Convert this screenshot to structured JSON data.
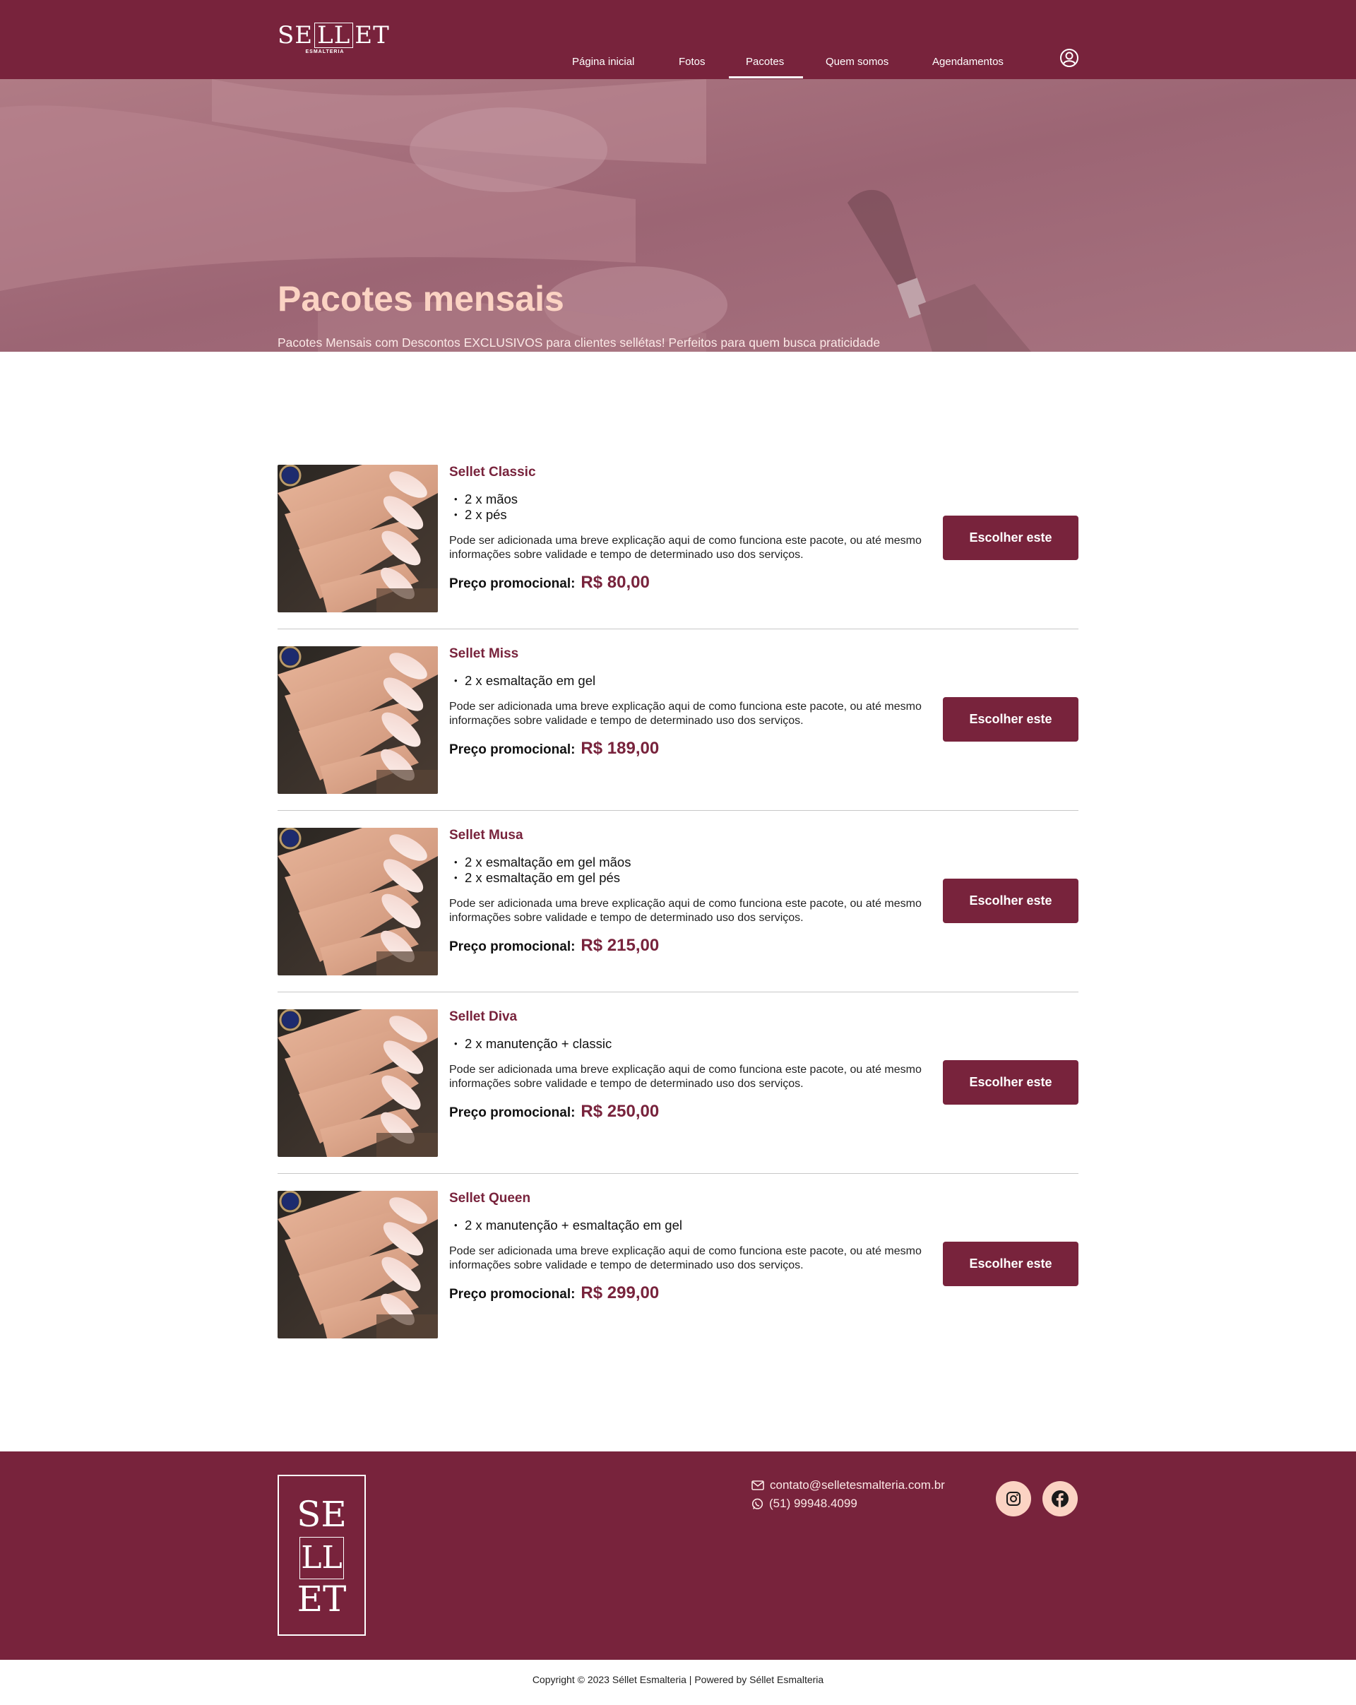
{
  "header": {
    "logo_text_left": "SE",
    "logo_text_box": "LL",
    "logo_text_right": "ET",
    "logo_subtitle": "ESMALTERIA",
    "nav": [
      {
        "label": "Página inicial"
      },
      {
        "label": "Fotos"
      },
      {
        "label": "Pacotes",
        "active": true
      },
      {
        "label": "Quem somos"
      },
      {
        "label": "Agendamentos"
      }
    ],
    "user_icon": "user-circle-icon"
  },
  "hero": {
    "title": "Pacotes mensais",
    "description": "Pacotes Mensais com Descontos EXCLUSIVOS para clientes sellétas! Perfeitos para quem busca praticidade e agendamentos fixos."
  },
  "packages": [
    {
      "name": "Sellet Classic",
      "items": [
        "2 x mãos",
        "2 x pés"
      ],
      "description": "Pode ser adicionada uma breve explicação aqui de como funciona este pacote, ou até mesmo informações sobre validade e tempo de determinado uso dos serviços.",
      "price_label": "Preço promocional:",
      "price": "R$ 80,00",
      "button": "Escolher este"
    },
    {
      "name": "Sellet Miss",
      "items": [
        "2 x esmaltação em gel"
      ],
      "description": "Pode ser adicionada uma breve explicação aqui de como funciona este pacote, ou até mesmo informações sobre validade e tempo de determinado uso dos serviços.",
      "price_label": "Preço promocional:",
      "price": "R$ 189,00",
      "button": "Escolher este"
    },
    {
      "name": "Sellet Musa",
      "items": [
        "2 x esmaltação em gel mãos",
        "2 x esmaltação em gel pés"
      ],
      "description": "Pode ser adicionada uma breve explicação aqui de como funciona este pacote, ou até mesmo informações sobre validade e tempo de determinado uso dos serviços.",
      "price_label": "Preço promocional:",
      "price": "R$ 215,00",
      "button": "Escolher este"
    },
    {
      "name": "Sellet Diva",
      "items": [
        "2 x manutenção + classic"
      ],
      "description": "Pode ser adicionada uma breve explicação aqui de como funciona este pacote, ou até mesmo informações sobre validade e tempo de determinado uso dos serviços.",
      "price_label": "Preço promocional:",
      "price": "R$ 250,00",
      "button": "Escolher este"
    },
    {
      "name": "Sellet Queen",
      "items": [
        "2 x manutenção + esmaltação em gel"
      ],
      "description": "Pode ser adicionada uma breve explicação aqui de como funciona este pacote, ou até mesmo informações sobre validade e tempo de determinado uso dos serviços.",
      "price_label": "Preço promocional:",
      "price": "R$ 299,00",
      "button": "Escolher este"
    }
  ],
  "footer": {
    "logo_line1": "SE",
    "logo_line2": "LL",
    "logo_line3": "ET",
    "email": "contato@selletesmalteria.com.br",
    "phone": "(51) 99948.4099",
    "email_icon": "envelope-icon",
    "phone_icon": "whatsapp-icon",
    "social": [
      "instagram-icon",
      "facebook-icon"
    ]
  },
  "copyright": "Copyright © 2023 Séllet Esmalteria | Powered by Séllet Esmalteria",
  "colors": {
    "brand": "#78233c",
    "accent_light": "#fbd3c3",
    "hero_overlay": "#a06b78"
  }
}
